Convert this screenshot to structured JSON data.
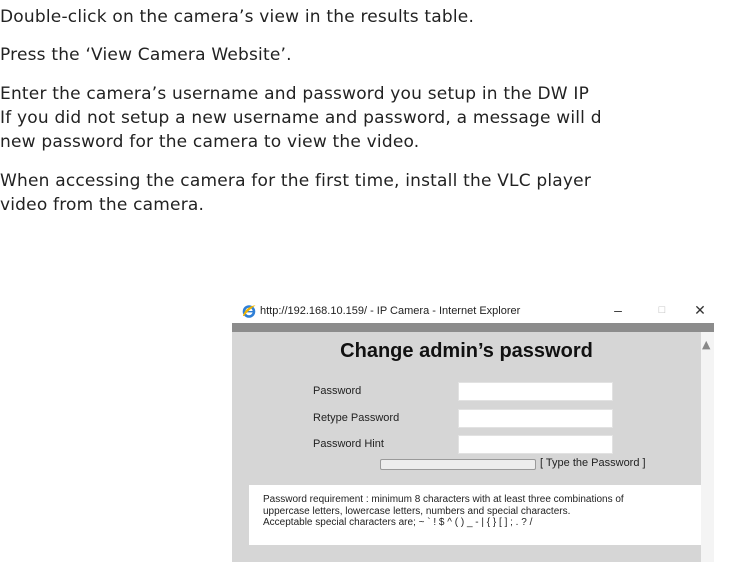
{
  "document": {
    "lines": [
      "Double-click on the camera’s view in the results table.",
      "Press the ‘View Camera Website’.",
      "Enter the camera’s username and password you setup in the DW IP",
      "If you did not setup a new username and password, a message will d",
      "new password for the camera to view the video.",
      "When accessing the camera for the first time, install the VLC player",
      "video from the camera."
    ]
  },
  "browser": {
    "title": "http://192.168.10.159/ - IP Camera - Internet Explorer",
    "minimize_glyph": "–",
    "maximize_glyph": "□",
    "close_glyph": "✕",
    "icon": "internet-explorer-icon"
  },
  "form": {
    "heading": "Change admin’s password",
    "password_label": "Password",
    "retype_label": "Retype Password",
    "hint_label": "Password Hint",
    "strength_text": "[ Type the Password ]",
    "requirement_lines": [
      "Password requirement : minimum 8 characters with at least three combinations of",
      "uppercase letters, lowercase letters, numbers and special characters.",
      "Acceptable special characters are; ~ ` ! $ ^ ( ) _ - | { } [ ] ; . ? /"
    ]
  },
  "colors": {
    "content_bg": "#d6d6d6",
    "topbar": "#8c8c8c",
    "text": "#222222"
  }
}
